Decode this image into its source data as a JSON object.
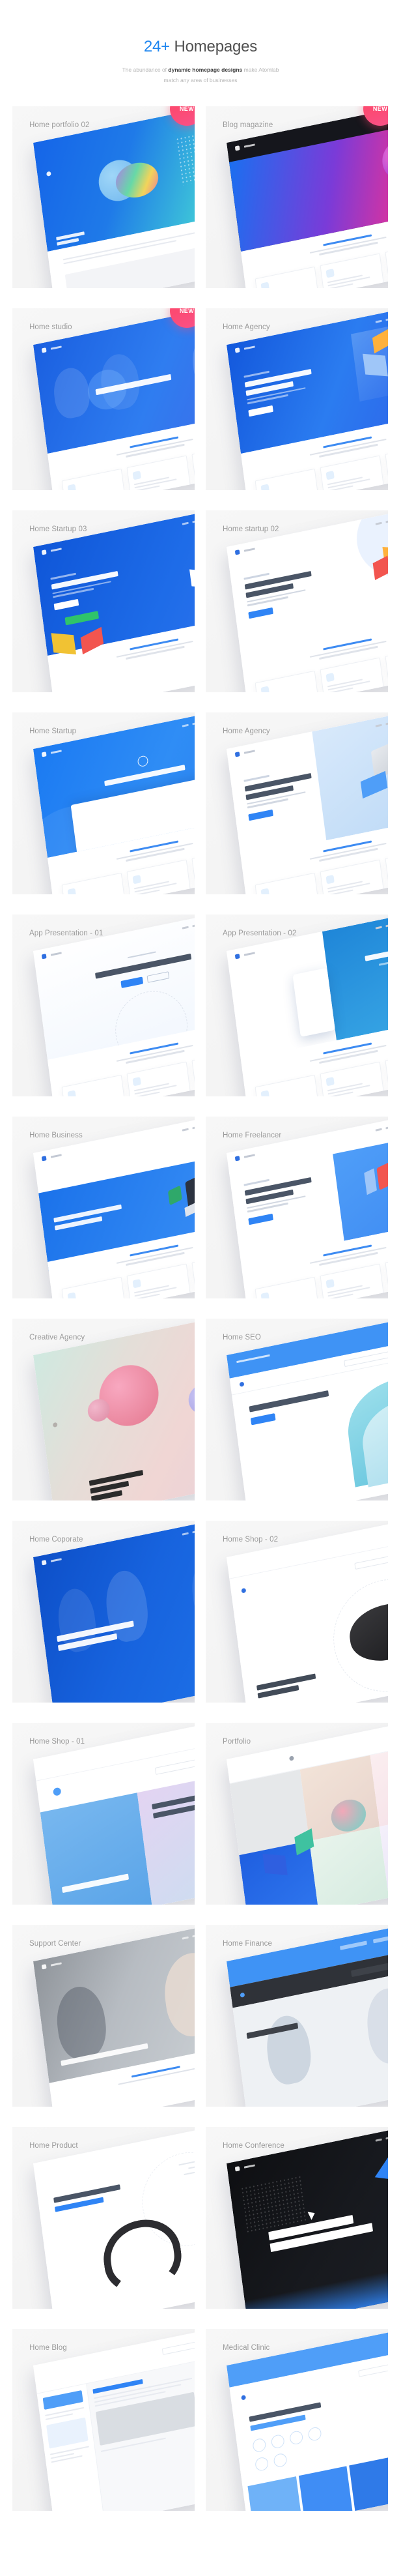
{
  "header": {
    "title_accent": "24+",
    "title_rest": " Homepages",
    "subtitle_part1": "The abundance of ",
    "subtitle_strong": "dynamic homepage designs",
    "subtitle_part2": " make Atomlab",
    "subtitle_line2": "match any area of businesses"
  },
  "badges": {
    "new_label": "NEW"
  },
  "colors": {
    "accent_blue": "#1e86f0",
    "badge_pink": "#fc4a72",
    "card_bg": "#f5f5f5",
    "title_grey": "#9a9a9a",
    "heading_grey": "#4a4a4a",
    "sub_grey": "#b6b6b6"
  },
  "cards": [
    {
      "title": "Home portfolio 02",
      "new": true,
      "style": "portfolio02"
    },
    {
      "title": "Blog magazine",
      "new": true,
      "style": "blogmag"
    },
    {
      "title": "Home studio",
      "new": true,
      "style": "studio"
    },
    {
      "title": "Home Agency",
      "new": false,
      "style": "agency1"
    },
    {
      "title": "Home Startup 03",
      "new": false,
      "style": "startup03"
    },
    {
      "title": "Home startup 02",
      "new": false,
      "style": "startup02"
    },
    {
      "title": "Home Startup",
      "new": false,
      "style": "startup01"
    },
    {
      "title": "Home Agency",
      "new": false,
      "style": "agency2"
    },
    {
      "title": "App Presentation - 01",
      "new": false,
      "style": "app01"
    },
    {
      "title": "App Presentation - 02",
      "new": false,
      "style": "app02"
    },
    {
      "title": "Home Business",
      "new": false,
      "style": "business"
    },
    {
      "title": "Home Freelancer",
      "new": false,
      "style": "freelancer"
    },
    {
      "title": "Creative Agency",
      "new": false,
      "style": "creative"
    },
    {
      "title": "Home SEO",
      "new": false,
      "style": "seo"
    },
    {
      "title": "Home Coporate",
      "new": false,
      "style": "corporate"
    },
    {
      "title": "Home Shop - 02",
      "new": false,
      "style": "shop02"
    },
    {
      "title": "Home Shop - 01",
      "new": false,
      "style": "shop01"
    },
    {
      "title": "Portfolio",
      "new": false,
      "style": "portfolio"
    },
    {
      "title": "Support Center",
      "new": false,
      "style": "support"
    },
    {
      "title": "Home Finance",
      "new": false,
      "style": "finance"
    },
    {
      "title": "Home Product",
      "new": false,
      "style": "product"
    },
    {
      "title": "Home Conference",
      "new": false,
      "style": "conference"
    },
    {
      "title": "Home Blog",
      "new": false,
      "style": "blog"
    },
    {
      "title": "Medical Clinic",
      "new": false,
      "style": "medical"
    }
  ]
}
